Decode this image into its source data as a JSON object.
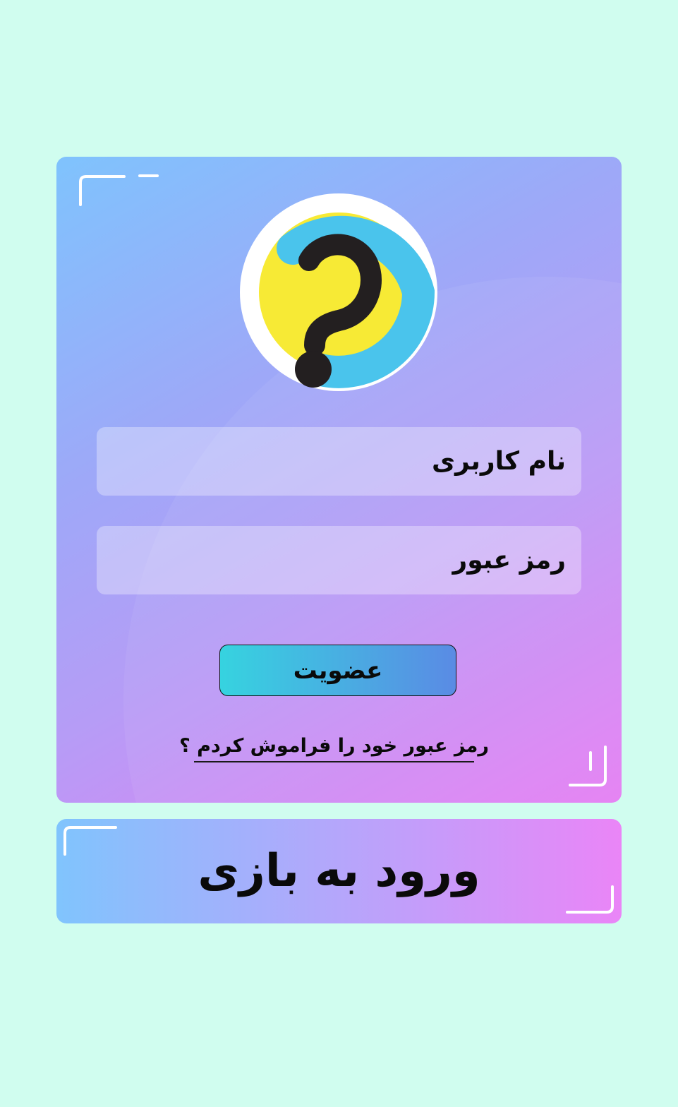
{
  "colors": {
    "page_background": "#d0fdef",
    "card_gradient_start": "#7fc3fd",
    "card_gradient_end": "#e57df3",
    "logo_yellow": "#f7ea35",
    "logo_blue": "#4ac4ec",
    "logo_dark": "#231f20",
    "button_gradient_start": "#36d3e0",
    "button_gradient_end": "#5a8be4"
  },
  "logo": {
    "icon": "question-mark-logo-icon"
  },
  "login_form": {
    "username_placeholder": "نام کاربری",
    "password_placeholder": "رمز عبور",
    "signup_label": "عضویت",
    "forgot_password_label": "رمز عبور خود را فراموش کردم ؟"
  },
  "enter_game": {
    "label": "ورود به بازی"
  }
}
